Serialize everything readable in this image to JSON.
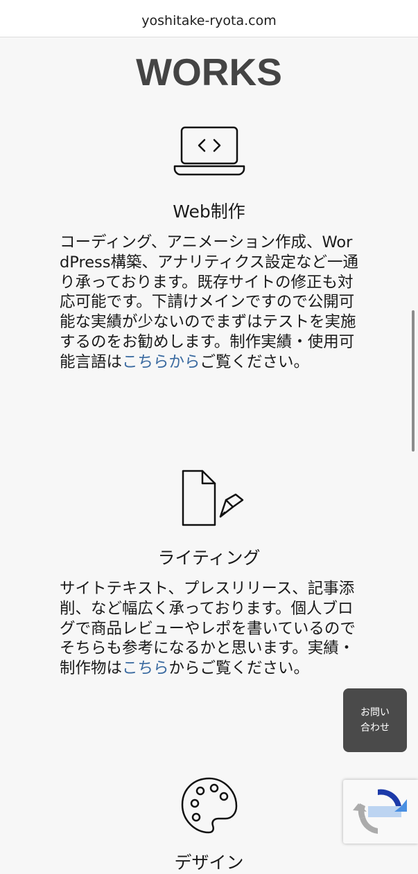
{
  "browser": {
    "url": "yoshitake-ryota.com"
  },
  "page": {
    "title": "WORKS"
  },
  "sections": [
    {
      "icon": "laptop-code-icon",
      "title": "Web制作",
      "body_text": "コーディング、アニメーション作成、WordPress構築、アナリティクス設定など一通り承っております。既存サイトの修正も対応可能です。下請けメインですので公開可能な実績が少ないのでまずはテストを実施するのをお勧めします。制作実績・使用可能言語は",
      "link_text": "こちらから",
      "body_after": "ご覧ください。"
    },
    {
      "icon": "document-pencil-icon",
      "title": "ライティング",
      "body_text": "サイトテキスト、プレスリリース、記事添削、など幅広く承っております。個人ブログで商品レビューやレポを書いているのでそちらも参考になるかと思います。実績・制作物は",
      "link_text": "こちら",
      "body_after": "からご覧ください。"
    },
    {
      "icon": "palette-icon",
      "title": "デザイン"
    }
  ],
  "contact_button": {
    "line1": "お問い",
    "line2": "合わせ"
  },
  "colors": {
    "background": "#f7f7f7",
    "title": "#444444",
    "link": "#3a6aa0",
    "contact_bg": "#4a4a4a"
  }
}
